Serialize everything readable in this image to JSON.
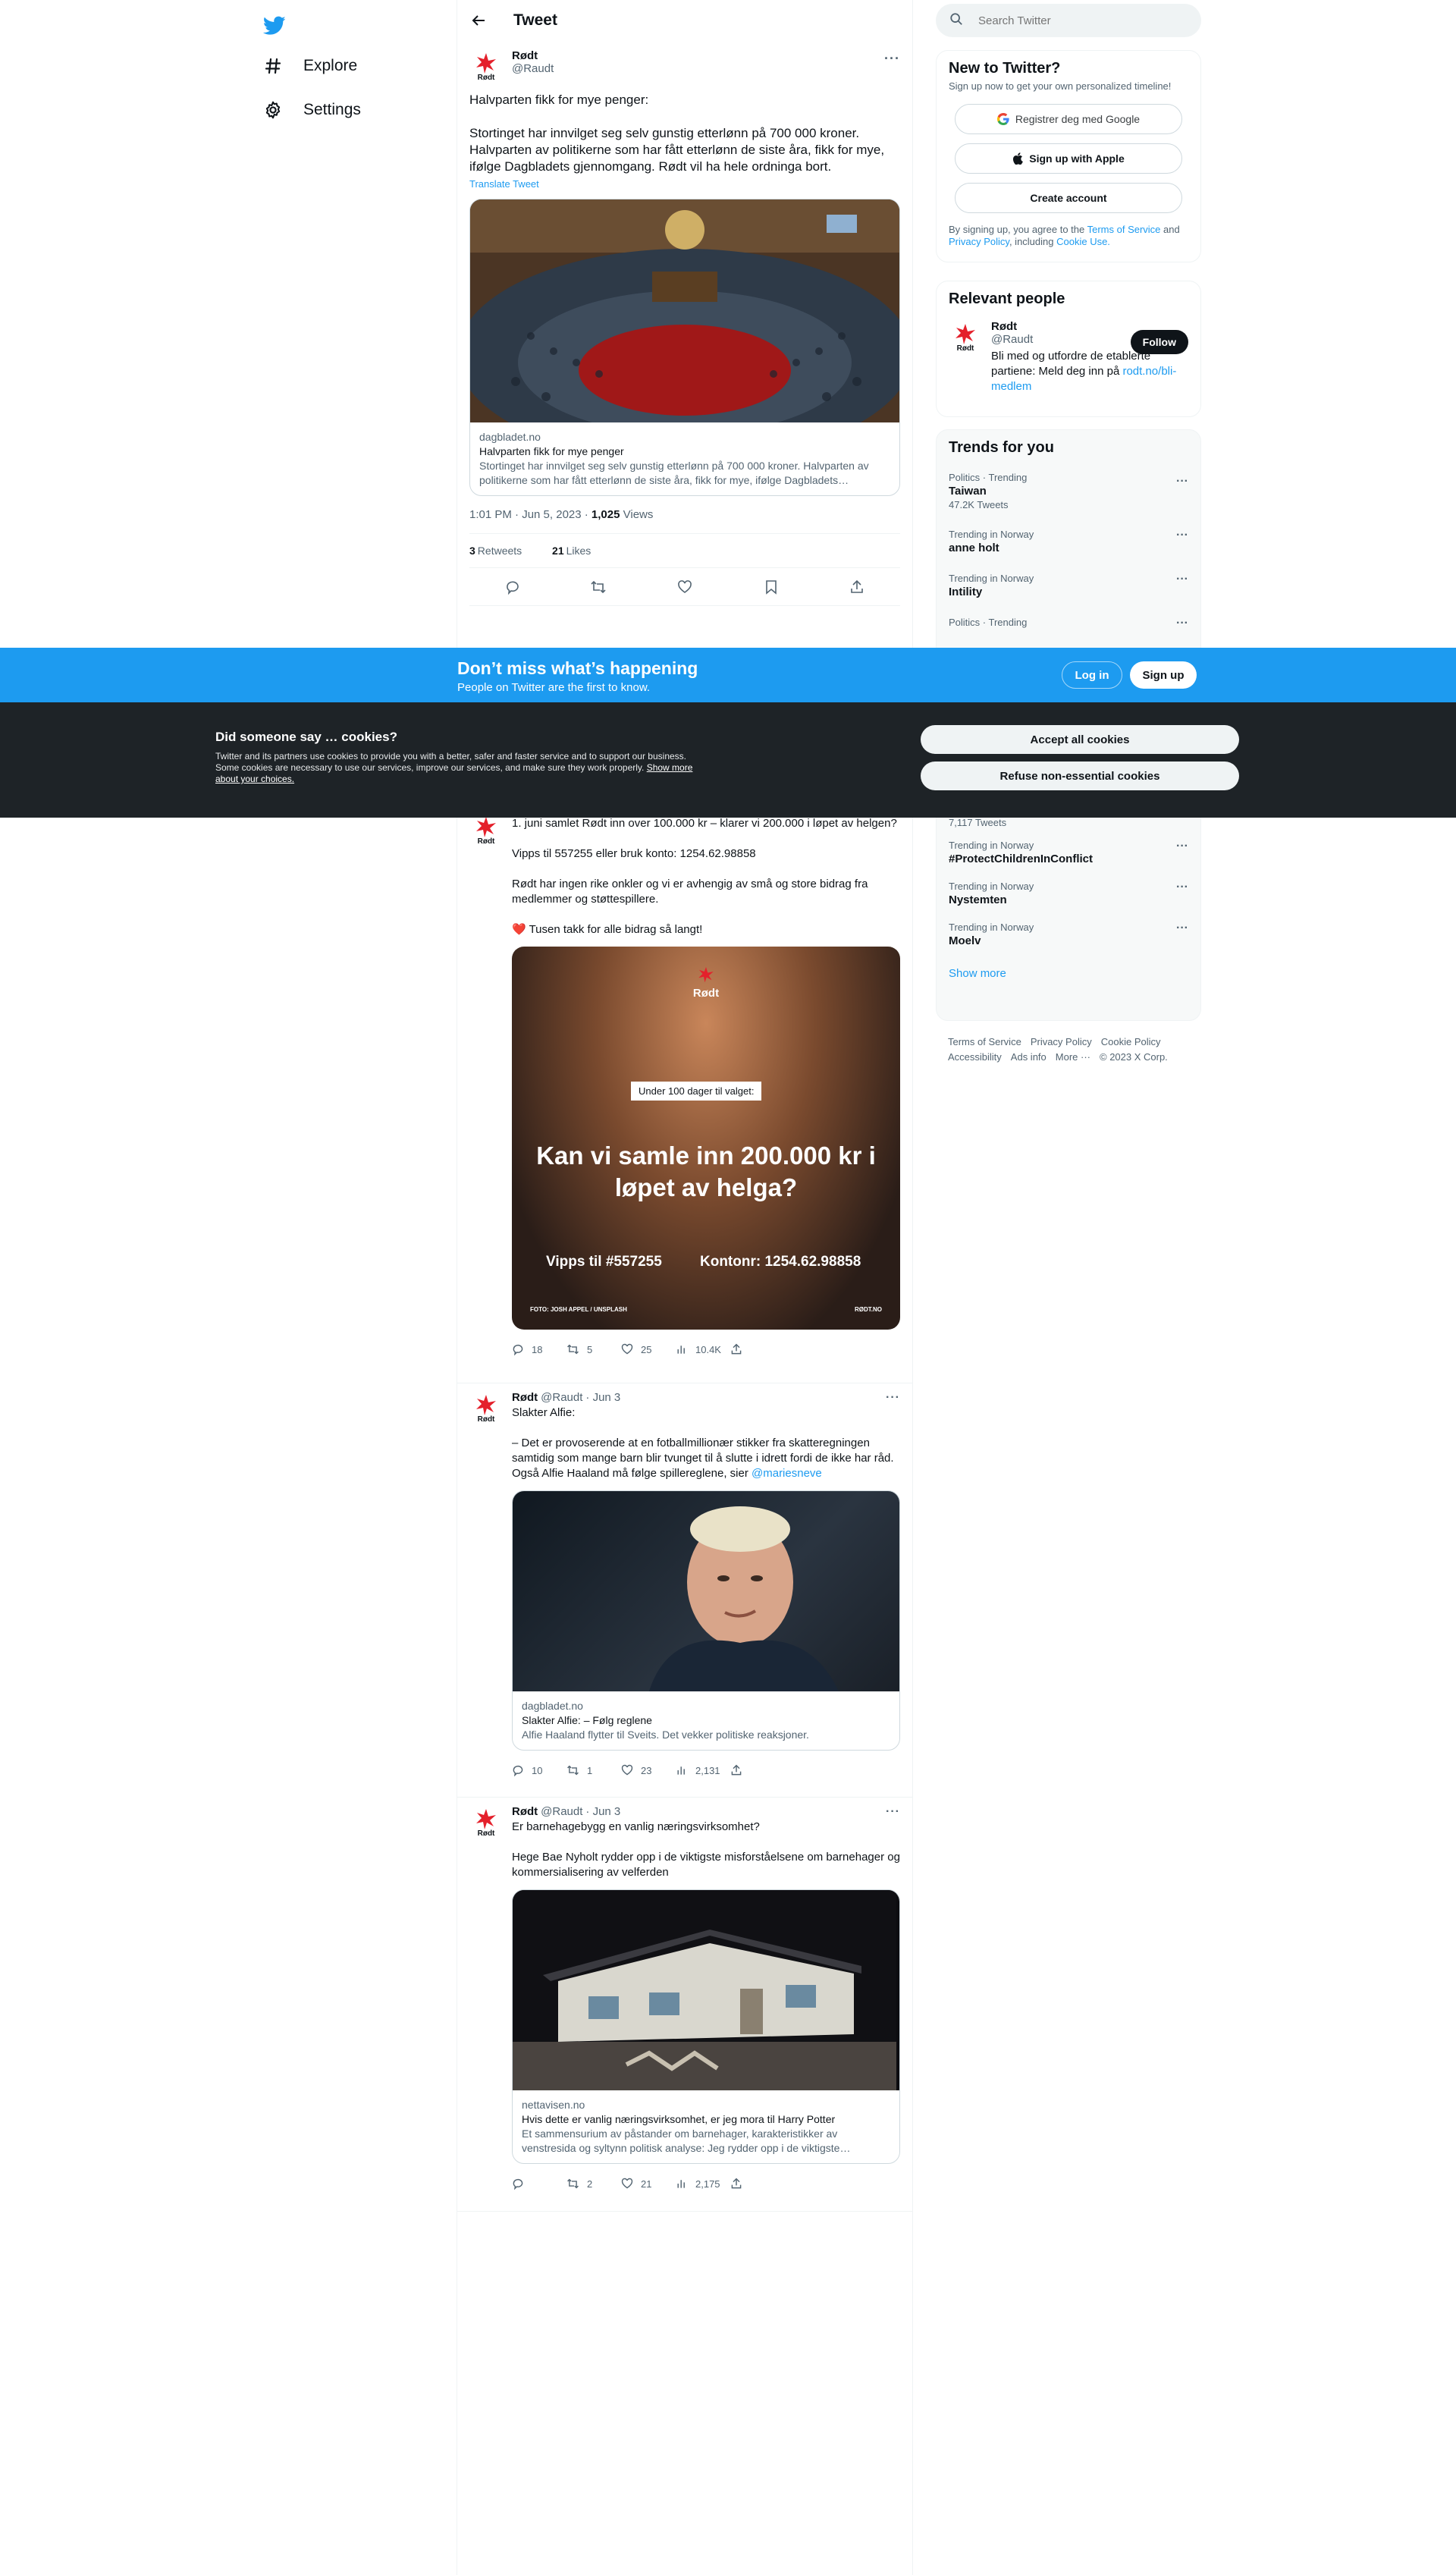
{
  "nav": {
    "items": [
      {
        "label": "Explore",
        "icon": "hashtag-icon"
      },
      {
        "label": "Settings",
        "icon": "gear-icon"
      }
    ]
  },
  "header": {
    "title": "Tweet"
  },
  "focal": {
    "name": "Rødt",
    "handle": "@Raudt",
    "text": "Halvparten fikk for mye penger:\n\nStortinget har innvilget seg selv gunstig etterlønn på 700 000 kroner. Halvparten av politikerne som har fått etterlønn de siste åra, fikk for mye, ifølge Dagbladets gjennomgang. Rødt vil ha hele ordninga bort.",
    "translate": "Translate Tweet",
    "card": {
      "domain": "dagbladet.no",
      "title": "Halvparten fikk for mye penger",
      "desc": "Stortinget har innvilget seg selv gunstig etterlønn på 700 000 kroner. Halvparten av politikerne som har fått etterlønn de siste åra, fikk for mye, ifølge Dagbladets gjennomgang."
    },
    "time": "1:01 PM · Jun 5, 2023 · ",
    "views_count": "1,025",
    "views_label": " Views",
    "retweets_count": "3",
    "retweets_label": "Retweets",
    "likes_count": "21",
    "likes_label": "Likes"
  },
  "tweets": [
    {
      "text": "1. juni samlet Rødt inn over 100.000 kr – klarer vi 200.000 i løpet av helgen?\n\nVipps til 557255 eller bruk konto: 1254.62.98858\n\nRødt har ingen rike onkler og vi er avhengig av små og store bidrag fra medlemmer og støttespillere.\n\n❤️ Tusen takk for alle bidrag så langt!",
      "image": {
        "badge": "Under 100 dager til valget:",
        "headline": "Kan vi samle inn 200.000 kr i løpet av helga?",
        "vipps": "Vipps til #557255",
        "konto": "Kontonr: 1254.62.98858",
        "credit": "FOTO: JOSH APPEL / UNSPLASH",
        "site": "RØDT.NO",
        "logo": "Rødt"
      },
      "replies": "18",
      "retweets": "5",
      "likes": "25",
      "views": "10.4K"
    },
    {
      "name": "Rødt",
      "handle": "@Raudt",
      "date": "· Jun 3",
      "text": "Slakter Alfie:\n\n– Det er provoserende at en fotballmillionær stikker fra skatteregningen samtidig som mange barn blir tvunget til å slutte i idrett fordi de ikke har råd. Også Alfie Haaland må følge spillereglene, sier ",
      "mention": "@mariesneve",
      "card": {
        "domain": "dagbladet.no",
        "title": "Slakter Alfie: – Følg reglene",
        "desc": "Alfie Haaland flytter til Sveits. Det vekker politiske reaksjoner."
      },
      "replies": "10",
      "retweets": "1",
      "likes": "23",
      "views": "2,131"
    },
    {
      "name": "Rødt",
      "handle": "@Raudt",
      "date": "· Jun 3",
      "text": "Er barnehagebygg en vanlig næringsvirksomhet?\n\nHege Bae Nyholt rydder opp i de viktigste misforståelsene om barnehager og kommersialisering av velferden",
      "card": {
        "domain": "nettavisen.no",
        "title": "Hvis dette er vanlig næringsvirksomhet, er jeg mora til Harry Potter",
        "desc": "Et sammensurium av påstander om barnehager, karakteristikker av venstresida og syltynn politisk analyse: Jeg rydder opp i de viktigste misforståelsene."
      },
      "replies": "",
      "retweets": "2",
      "likes": "21",
      "views": "2,175"
    }
  ],
  "search": {
    "placeholder": "Search Twitter"
  },
  "newbox": {
    "title": "New to Twitter?",
    "sub": "Sign up now to get your own personalized timeline!",
    "google": "Registrer deg med Google",
    "apple": "Sign up with Apple",
    "create": "Create account",
    "legal_pre": "By signing up, you agree to the ",
    "tos": "Terms of Service",
    "and": " and ",
    "privacy": "Privacy Policy",
    "including": ", including ",
    "cookie": "Cookie Use."
  },
  "relevant": {
    "title": "Relevant people",
    "name": "Rødt",
    "handle": "@Raudt",
    "follow": "Follow",
    "bio": "Bli med og utfordre de etablerte partiene: Meld deg inn på ",
    "link": "rodt.no/bli-medlem"
  },
  "trends": {
    "title": "Trends for you",
    "top": [
      {
        "ctx": "Politics · Trending",
        "name": "Taiwan",
        "count": "47.2K Tweets"
      },
      {
        "ctx": "Trending in Norway",
        "name": "anne holt",
        "count": ""
      },
      {
        "ctx": "Trending in Norway",
        "name": "Intility",
        "count": ""
      },
      {
        "ctx": "Politics · Trending",
        "name": "",
        "count": ""
      }
    ],
    "bottom_count": "7,117 Tweets",
    "bottom": [
      {
        "ctx": "Trending in Norway",
        "name": "#ProtectChildrenInConflict"
      },
      {
        "ctx": "Trending in Norway",
        "name": "Nystemten"
      },
      {
        "ctx": "Trending in Norway",
        "name": "Moelv"
      }
    ],
    "show_more": "Show more"
  },
  "footer": {
    "links": [
      "Terms of Service",
      "Privacy Policy",
      "Cookie Policy",
      "Accessibility",
      "Ads info",
      "More ···",
      "© 2023 X Corp."
    ]
  },
  "dontmiss": {
    "title": "Don’t miss what’s happening",
    "sub": "People on Twitter are the first to know.",
    "login": "Log in",
    "signup": "Sign up"
  },
  "cookies": {
    "title": "Did someone say … cookies?",
    "body": "Twitter and its partners use cookies to provide you with a better, safer and faster service and to support our business. Some cookies are necessary to use our services, improve our services, and make sure they work properly. ",
    "link": "Show more about your choices.",
    "accept": "Accept all cookies",
    "refuse": "Refuse non-essential cookies"
  },
  "colors": {
    "accent": "#1d9bf0",
    "rodt_red": "#e4202b",
    "cookie_bg": "#1e2327"
  }
}
